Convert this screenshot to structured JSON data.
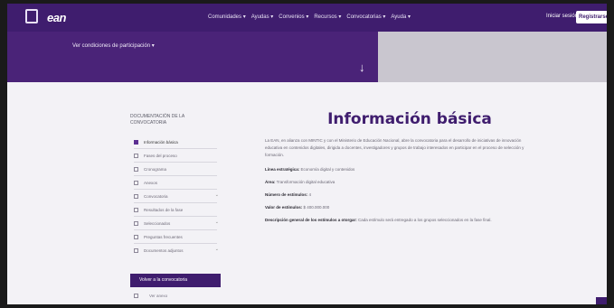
{
  "topnav": {
    "logo_text": "ean",
    "menu": [
      "Comunidades ▾",
      "Ayudas ▾",
      "Convenios ▾",
      "Recursos ▾",
      "Convocatorias ▾",
      "Ayuda ▾"
    ],
    "login": "Iniciar sesión",
    "register": "Registrarse"
  },
  "hero": {
    "text": "Ver condiciones de participación ▾",
    "arrow": "↓"
  },
  "sidebar": {
    "title": "DOCUMENTACIÓN DE LA CONVOCATORIA",
    "items": [
      {
        "label": "Información básica",
        "active": true,
        "chevron": false
      },
      {
        "label": "Fases del proceso",
        "active": false,
        "chevron": false
      },
      {
        "label": "Cronograma",
        "active": false,
        "chevron": false
      },
      {
        "label": "Anexos",
        "active": false,
        "chevron": false
      },
      {
        "label": "Convocatoria",
        "active": false,
        "chevron": true
      },
      {
        "label": "Resultados de la fase",
        "active": false,
        "chevron": false
      },
      {
        "label": "Seleccionados",
        "active": false,
        "chevron": true
      },
      {
        "label": "Preguntas frecuentes",
        "active": false,
        "chevron": false
      },
      {
        "label": "Documentos adjuntos",
        "active": false,
        "chevron": true
      }
    ],
    "button": "Volver a la convocatoria",
    "next": "Ver anexo"
  },
  "main": {
    "title": "Información básica",
    "intro": "La EAN, en alianza con MINTIC y con el Ministerio de Educación Nacional, abre la convocatoria para el desarrollo de iniciativas de innovación educativa en contenidos digitales, dirigida a docentes, investigadores y grupos de trabajo interesados en participar en el proceso de selección y formación.",
    "fields": [
      {
        "label": "Línea estratégica:",
        "value": " Economía digital y contenidos"
      },
      {
        "label": "Área:",
        "value": " Transformación digital educativa"
      },
      {
        "label": "Número de estímulos:",
        "value": " 4"
      },
      {
        "label": "Valor de estímulos:",
        "value": " $ 400.000.000"
      },
      {
        "label": "Descripción general de los estímulos a otorgar:",
        "value": " Cada estímulo será entregado a los grupos seleccionados en la fase final."
      }
    ]
  }
}
